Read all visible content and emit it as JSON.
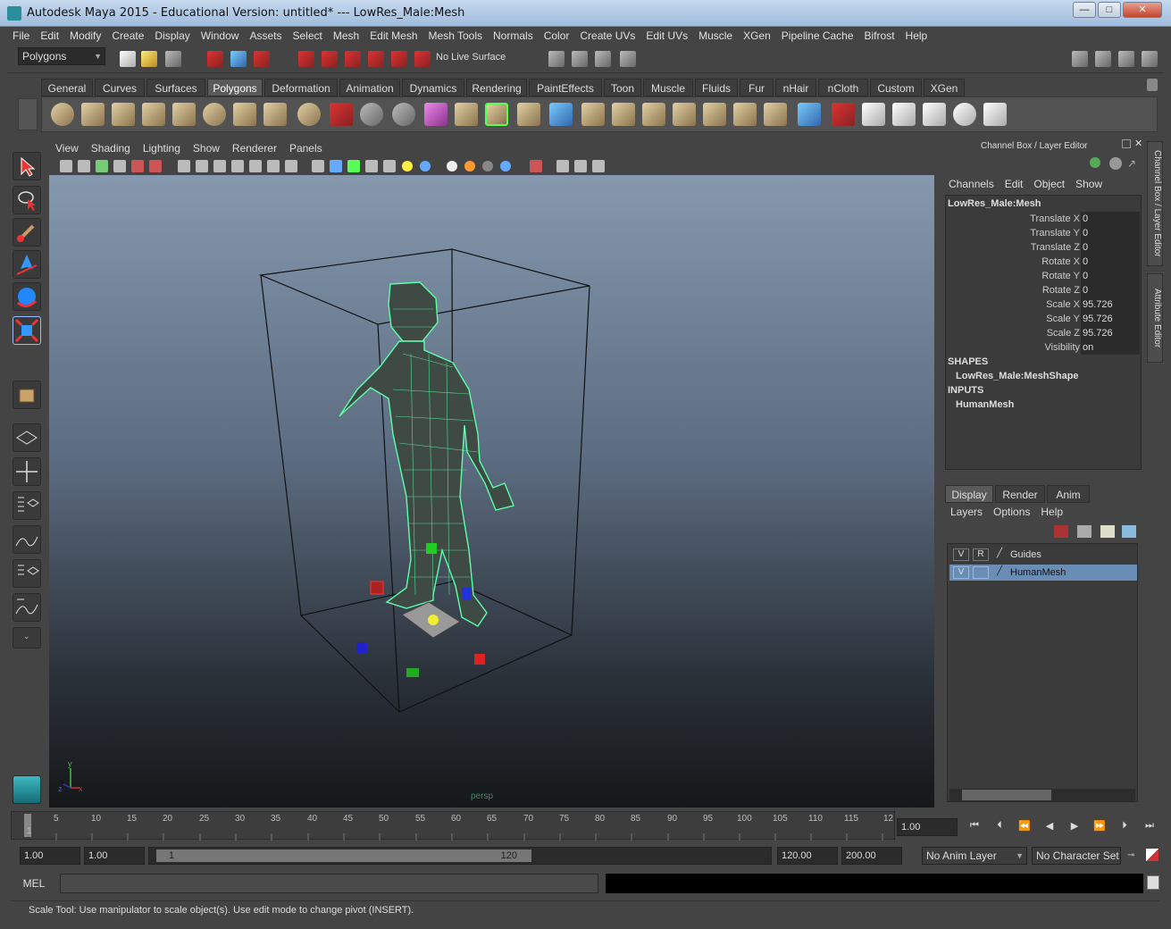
{
  "window": {
    "title": "Autodesk Maya 2015 - Educational Version: untitled*  ---  LowRes_Male:Mesh",
    "min_label": "—",
    "max_label": "□",
    "close_label": "✕"
  },
  "menubar": [
    "File",
    "Edit",
    "Modify",
    "Create",
    "Display",
    "Window",
    "Assets",
    "Select",
    "Mesh",
    "Edit Mesh",
    "Mesh Tools",
    "Normals",
    "Color",
    "Create UVs",
    "Edit UVs",
    "Muscle",
    "XGen",
    "Pipeline Cache",
    "Bifrost",
    "Help"
  ],
  "statusline": {
    "menuset": "Polygons",
    "live_surface": "No Live Surface"
  },
  "shelf_tabs": [
    "General",
    "Curves",
    "Surfaces",
    "Polygons",
    "Deformation",
    "Animation",
    "Dynamics",
    "Rendering",
    "PaintEffects",
    "Toon",
    "Muscle",
    "Fluids",
    "Fur",
    "nHair",
    "nCloth",
    "Custom",
    "XGen"
  ],
  "shelf_active_tab": "Polygons",
  "panel_menu": [
    "View",
    "Shading",
    "Lighting",
    "Show",
    "Renderer",
    "Panels"
  ],
  "viewport": {
    "camera_label": "persp",
    "axis_x": "x",
    "axis_y": "y",
    "axis_z": "z"
  },
  "channel_box": {
    "header": "Channel Box / Layer Editor",
    "menu": [
      "Channels",
      "Edit",
      "Object",
      "Show"
    ],
    "object_name": "LowRes_Male:Mesh",
    "attributes": [
      {
        "label": "Translate X",
        "value": "0"
      },
      {
        "label": "Translate Y",
        "value": "0"
      },
      {
        "label": "Translate Z",
        "value": "0"
      },
      {
        "label": "Rotate X",
        "value": "0"
      },
      {
        "label": "Rotate Y",
        "value": "0"
      },
      {
        "label": "Rotate Z",
        "value": "0"
      },
      {
        "label": "Scale X",
        "value": "95.726"
      },
      {
        "label": "Scale Y",
        "value": "95.726"
      },
      {
        "label": "Scale Z",
        "value": "95.726"
      },
      {
        "label": "Visibility",
        "value": "on"
      }
    ],
    "shapes_label": "SHAPES",
    "shape_name": "LowRes_Male:MeshShape",
    "inputs_label": "INPUTS",
    "input_name": "HumanMesh"
  },
  "side_tabs": [
    "Channel Box / Layer Editor",
    "Attribute Editor"
  ],
  "layer_editor": {
    "tabs": [
      "Display",
      "Render",
      "Anim"
    ],
    "active_tab": "Display",
    "menu": [
      "Layers",
      "Options",
      "Help"
    ],
    "layers": [
      {
        "v": "V",
        "r": "R",
        "name": "Guides",
        "selected": false
      },
      {
        "v": "V",
        "r": "",
        "name": "HumanMesh",
        "selected": true
      }
    ]
  },
  "timeline": {
    "ticks": [
      "1",
      "5",
      "10",
      "15",
      "20",
      "25",
      "30",
      "35",
      "40",
      "45",
      "50",
      "55",
      "60",
      "65",
      "70",
      "75",
      "80",
      "85",
      "90",
      "95",
      "100",
      "105",
      "110",
      "115",
      "12"
    ],
    "current_frame": "1.00"
  },
  "range": {
    "start_time": "1.00",
    "playback_start": "1.00",
    "slider_start": "1",
    "slider_end": "120",
    "playback_end": "120.00",
    "end_time": "200.00",
    "anim_layer": "No Anim Layer",
    "character_set": "No Character Set"
  },
  "command_line": {
    "mode": "MEL"
  },
  "help_line": "Scale Tool: Use manipulator to scale object(s). Use edit mode to change pivot (INSERT).",
  "colors": {
    "ui_bg": "#444444",
    "wireframe": "#5dffa8",
    "selection": "#6a8db5"
  }
}
